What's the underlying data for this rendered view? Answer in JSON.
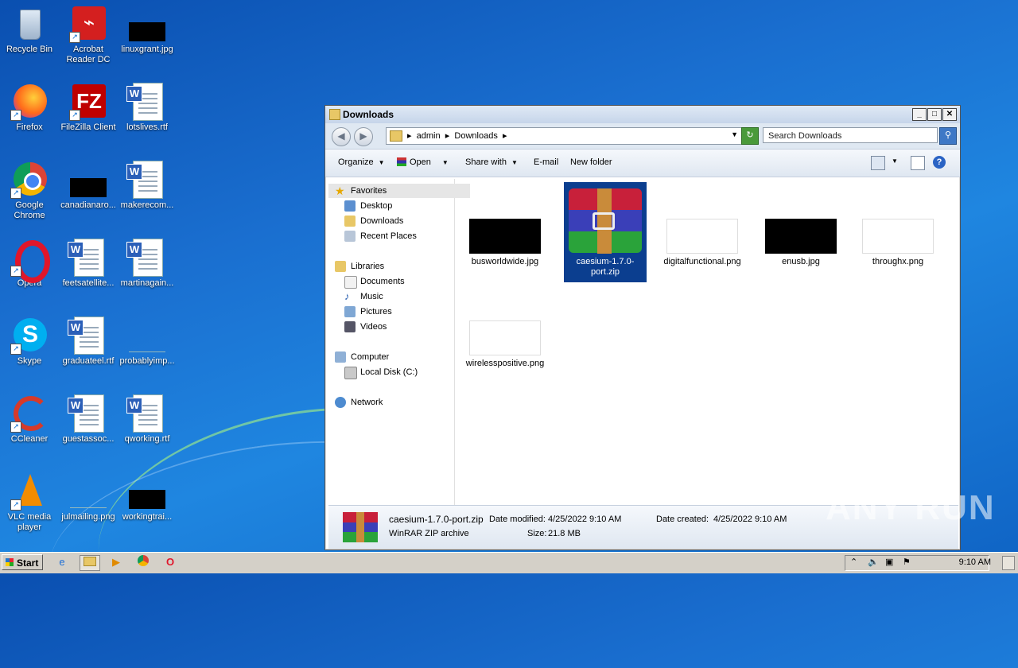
{
  "desktop": {
    "icons": [
      {
        "label": "Recycle Bin"
      },
      {
        "label": "Acrobat Reader DC"
      },
      {
        "label": "linuxgrant.jpg"
      },
      {
        "label": "Firefox"
      },
      {
        "label": "FileZilla Client"
      },
      {
        "label": "lotslives.rtf"
      },
      {
        "label": "Google Chrome"
      },
      {
        "label": "canadianaro..."
      },
      {
        "label": "makerecom..."
      },
      {
        "label": "Opera"
      },
      {
        "label": "feetsatellite..."
      },
      {
        "label": "martinagain..."
      },
      {
        "label": "Skype"
      },
      {
        "label": "graduateel.rtf"
      },
      {
        "label": "probablyimp..."
      },
      {
        "label": "CCleaner"
      },
      {
        "label": "guestassoc..."
      },
      {
        "label": "qworking.rtf"
      },
      {
        "label": "VLC media player"
      },
      {
        "label": "julmailing.png"
      },
      {
        "label": "workingtrai..."
      }
    ]
  },
  "window": {
    "title": "Downloads",
    "buttons": {
      "minimize": "_",
      "maximize": "□",
      "close": "✕"
    },
    "address": {
      "crumb1": "admin",
      "crumb2": "Downloads",
      "sep": "▸"
    },
    "search_placeholder": "Search Downloads",
    "toolbar": {
      "organize": "Organize",
      "open": "Open",
      "share": "Share with",
      "email": "E-mail",
      "newfolder": "New folder"
    },
    "nav": {
      "favorites": "Favorites",
      "desktop": "Desktop",
      "downloads": "Downloads",
      "recent": "Recent Places",
      "libraries": "Libraries",
      "documents": "Documents",
      "music": "Music",
      "pictures": "Pictures",
      "videos": "Videos",
      "computer": "Computer",
      "localdisk": "Local Disk (C:)",
      "network": "Network"
    },
    "files": [
      {
        "name": "busworldwide.jpg"
      },
      {
        "name": "caesium-1.7.0-port.zip"
      },
      {
        "name": "digitalfunctional.png"
      },
      {
        "name": "enusb.jpg"
      },
      {
        "name": "throughx.png"
      },
      {
        "name": "wirelesspositive.png"
      }
    ],
    "details": {
      "filename": "caesium-1.7.0-port.zip",
      "type": "WinRAR ZIP archive",
      "modified_label": "Date modified:",
      "modified": "4/25/2022 9:10 AM",
      "size_label": "Size:",
      "size": "21.8 MB",
      "created_label": "Date created:",
      "created": "4/25/2022 9:10 AM"
    }
  },
  "taskbar": {
    "start": "Start",
    "clock": "9:10 AM"
  },
  "watermark": "ANY RUN"
}
